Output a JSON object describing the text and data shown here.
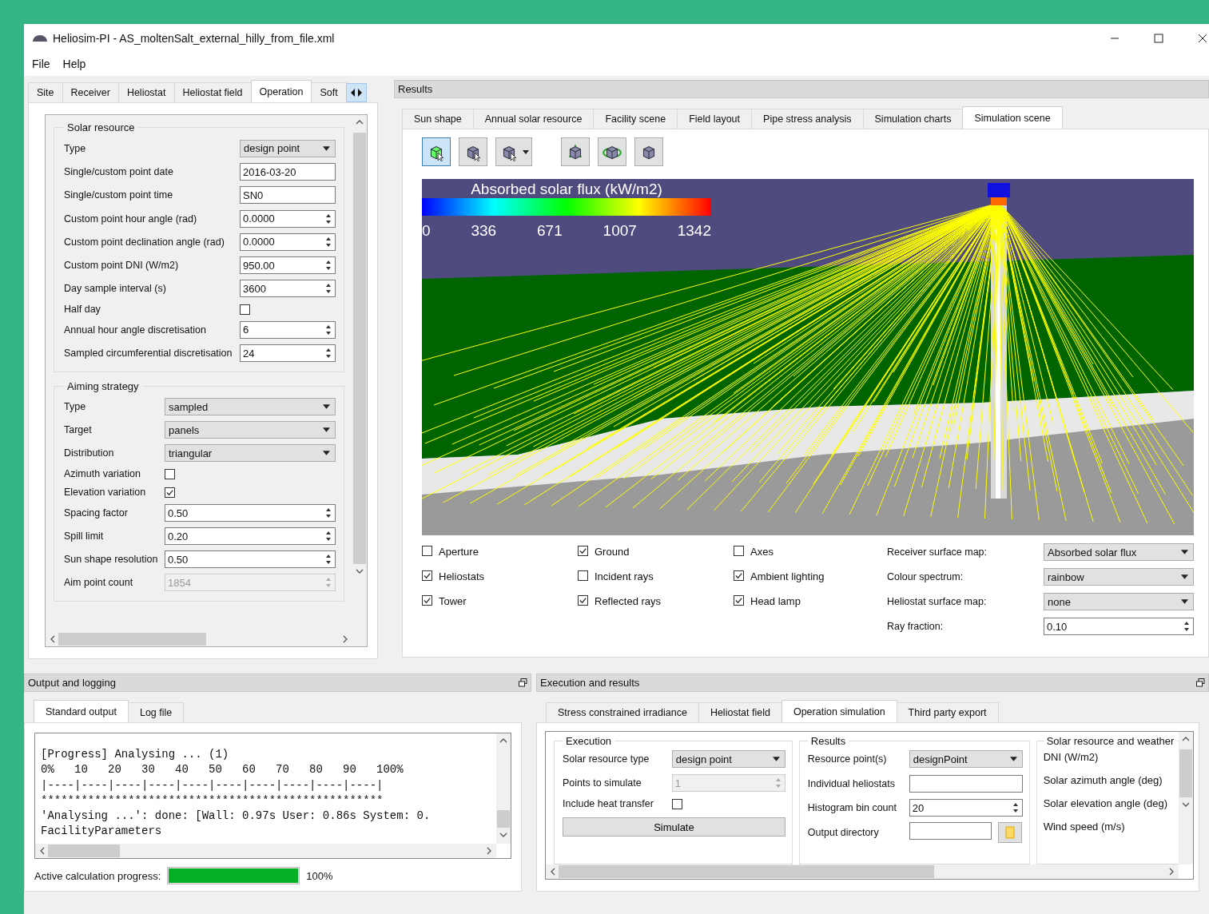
{
  "window": {
    "title": "Heliosim-PI - AS_moltenSalt_external_hilly_from_file.xml"
  },
  "menu": [
    "File",
    "Help"
  ],
  "left_tabs": [
    {
      "label": "Site",
      "selected": false
    },
    {
      "label": "Receiver",
      "selected": false
    },
    {
      "label": "Heliostat",
      "selected": false
    },
    {
      "label": "Heliostat field",
      "selected": false
    },
    {
      "label": "Operation",
      "selected": true
    },
    {
      "label": "Soft",
      "selected": false
    }
  ],
  "solar_resource": {
    "title": "Solar resource",
    "rows": [
      {
        "label": "Type",
        "kind": "combo",
        "value": "design point"
      },
      {
        "label": "Single/custom point date",
        "kind": "text",
        "value": "2016-03-20"
      },
      {
        "label": "Single/custom point time",
        "kind": "text",
        "value": "SN0"
      },
      {
        "label": "Custom point hour angle (rad)",
        "kind": "spin",
        "value": "0.0000",
        "disabled": false
      },
      {
        "label": "Custom point declination angle (rad)",
        "kind": "spin",
        "value": "0.0000",
        "disabled": false
      },
      {
        "label": "Custom point DNI (W/m2)",
        "kind": "spin",
        "value": "950.00",
        "disabled": false
      },
      {
        "label": "Day sample interval (s)",
        "kind": "spin",
        "value": "3600",
        "disabled": false
      },
      {
        "label": "Half day",
        "kind": "check",
        "checked": false
      },
      {
        "label": "Annual hour angle discretisation",
        "kind": "spin",
        "value": "6",
        "disabled": false
      },
      {
        "label": "Sampled circumferential discretisation",
        "kind": "spin",
        "value": "24",
        "disabled": false
      }
    ]
  },
  "aiming_strategy": {
    "title": "Aiming strategy",
    "rows": [
      {
        "label": "Type",
        "kind": "combo",
        "value": "sampled"
      },
      {
        "label": "Target",
        "kind": "combo",
        "value": "panels"
      },
      {
        "label": "Distribution",
        "kind": "combo",
        "value": "triangular"
      },
      {
        "label": "Azimuth variation",
        "kind": "check",
        "checked": false
      },
      {
        "label": "Elevation variation",
        "kind": "check",
        "checked": true
      },
      {
        "label": "Spacing factor",
        "kind": "spin",
        "value": "0.50",
        "disabled": false
      },
      {
        "label": "Spill limit",
        "kind": "spin",
        "value": "0.20",
        "disabled": false
      },
      {
        "label": "Sun shape resolution",
        "kind": "spin",
        "value": "0.50",
        "disabled": false
      },
      {
        "label": "Aim point count",
        "kind": "spin",
        "value": "1854",
        "disabled": true
      }
    ]
  },
  "results": {
    "title": "Results",
    "tabs": [
      {
        "label": "Sun shape",
        "selected": false
      },
      {
        "label": "Annual solar resource",
        "selected": false
      },
      {
        "label": "Facility scene",
        "selected": false
      },
      {
        "label": "Field layout",
        "selected": false
      },
      {
        "label": "Pipe stress analysis",
        "selected": false
      },
      {
        "label": "Simulation charts",
        "selected": false
      },
      {
        "label": "Simulation scene",
        "selected": true
      }
    ],
    "scene": {
      "legend_title": "Absorbed solar flux (kW/m2)",
      "legend_ticks": [
        "0",
        "336",
        "671",
        "1007",
        "1342"
      ]
    },
    "options": [
      {
        "label": "Aperture",
        "checked": false
      },
      {
        "label": "Heliostats",
        "checked": true
      },
      {
        "label": "Tower",
        "checked": true
      },
      {
        "label": "Ground",
        "checked": true
      },
      {
        "label": "Incident rays",
        "checked": false
      },
      {
        "label": "Reflected rays",
        "checked": true
      },
      {
        "label": "Axes",
        "checked": false
      },
      {
        "label": "Ambient lighting",
        "checked": true
      },
      {
        "label": "Head lamp",
        "checked": true
      }
    ],
    "maps": [
      {
        "label": "Receiver surface map:",
        "kind": "combo",
        "value": "Absorbed solar flux"
      },
      {
        "label": "Colour spectrum:",
        "kind": "combo",
        "value": "rainbow"
      },
      {
        "label": "Heliostat surface map:",
        "kind": "combo",
        "value": "none"
      },
      {
        "label": "Ray fraction:",
        "kind": "spin",
        "value": "0.10",
        "disabled": false
      }
    ]
  },
  "output": {
    "title": "Output and logging",
    "tabs": [
      {
        "label": "Standard output",
        "selected": true
      },
      {
        "label": "Log file",
        "selected": false
      }
    ],
    "log_lines": [
      "[Progress] Analysing ... (1)",
      "0%   10   20   30   40   50   60   70   80   90   100%",
      "|----|----|----|----|----|----|----|----|----|----|",
      "***************************************************",
      "'Analysing ...': done: [Wall: 0.97s User: 0.86s System: 0.",
      "FacilityParameters"
    ],
    "progress": {
      "label": "Active calculation progress:",
      "level": 1,
      "reading": "100%"
    }
  },
  "execution": {
    "title": "Execution and results",
    "tabs": [
      {
        "label": "Stress constrained irradiance",
        "selected": false
      },
      {
        "label": "Heliostat field",
        "selected": false
      },
      {
        "label": "Operation simulation",
        "selected": true
      },
      {
        "label": "Third party export",
        "selected": false
      }
    ],
    "execution_group": {
      "title": "Execution",
      "rows": [
        {
          "label": "Solar resource type",
          "kind": "combo",
          "value": "design point"
        },
        {
          "label": "Points to simulate",
          "kind": "spin",
          "value": "1",
          "disabled": true
        },
        {
          "label": "Include heat transfer",
          "kind": "check",
          "checked": false
        }
      ],
      "button": "Simulate"
    },
    "results_group": {
      "title": "Results",
      "rows": [
        {
          "label": "Resource point(s)",
          "kind": "combo",
          "value": "designPoint"
        },
        {
          "label": "Individual heliostats",
          "kind": "text"
        },
        {
          "label": "Histogram bin count",
          "kind": "spin",
          "value": "20",
          "disabled": false
        },
        {
          "label": "Output directory",
          "kind": "folder"
        }
      ]
    },
    "weather_group": {
      "title": "Solar resource and weather",
      "items": [
        "DNI (W/m2)",
        "Solar azimuth angle (deg)",
        "Solar elevation angle (deg)",
        "Wind speed (m/s)"
      ]
    }
  }
}
